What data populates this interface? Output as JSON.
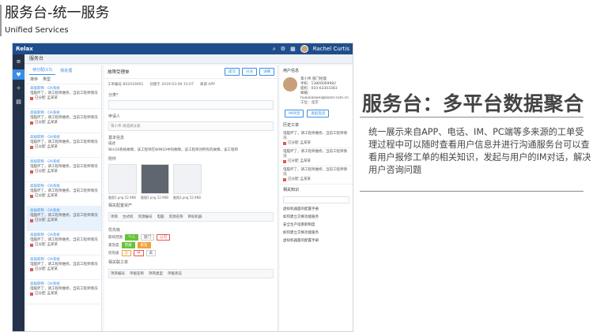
{
  "slide": {
    "title": "服务台-统一服务",
    "subtitle": "Unified Services",
    "headline": "服务台：多平台数据聚合",
    "description": "统一展示来自APP、电话、IM、PC端等多来源的工单受理过程中可以随时查看用户信息并进行沟通服务台可以查看用户报修工单的相关知识，发起与用户的IM对话，解决用户咨询问题"
  },
  "app": {
    "brand": "Relax",
    "user_name": "Rachel Curtis",
    "page_title": "服务台",
    "rail_icons": [
      "menu-icon",
      "heart-icon",
      "gear-icon",
      "document-icon"
    ],
    "list": {
      "tabs": [
        "待分配(13)",
        "我处理"
      ],
      "filter": [
        "排序",
        "类型"
      ],
      "tickets": [
        {
          "title": "高级职称 · OA系统",
          "desc": "电脑坏了，请工程师维修，当前工程师情况",
          "status": "已分配",
          "user": "孟某某"
        },
        {
          "title": "高级职称 · OA系统",
          "desc": "电脑坏了，请工程师维修，当前工程师情况",
          "status": "已分配",
          "user": "孟某某"
        },
        {
          "title": "高级职称 · OA系统",
          "desc": "电脑坏了，请工程师维修，当前工程师情况",
          "status": "已分配",
          "user": "孟某某"
        },
        {
          "title": "高级职称 · OA系统",
          "desc": "电脑坏了，请工程师维修，当前工程师情况",
          "status": "已分配",
          "user": "孟某某"
        },
        {
          "title": "高级职称 · OA系统",
          "desc": "电脑坏了，请工程师维修，当前工程师情况",
          "status": "已分配",
          "user": "孟某某"
        },
        {
          "title": "高级职称 · OA系统",
          "desc": "电脑坏了，请工程师维修，当前工程师情况",
          "status": "已分配",
          "user": "孟某某"
        },
        {
          "title": "高级职称 · OA系统",
          "desc": "电脑坏了，请工程师维修，当前工程师情况",
          "status": "已分配",
          "user": "孟某某"
        },
        {
          "title": "高级职称 · OA系统",
          "desc": "电脑坏了，请工程师维修，当前工程师情况",
          "status": "已分配",
          "user": "孟某某"
        },
        {
          "title": "高级职称 · OA系统",
          "desc": "电脑坏了，请工程师维修，当前工程师情况",
          "status": "已分配",
          "user": "孟某某"
        }
      ]
    },
    "detail": {
      "title": "故障受理单",
      "buttons": [
        "提交",
        "分派",
        "详细"
      ],
      "meta": [
        "工单编号 BS2019001",
        "创建于 2019-03-09 15:07",
        "来源 APP"
      ],
      "label_category": "分类*",
      "label_person": "申请人",
      "person_value": "蒋小伟 请选择分类",
      "label_desc": "基本信息",
      "desc_label": "描述",
      "desc_text": "Win10系统故障，该工程师在WIN10中的故障，该工程师对所有的故障，该工程师",
      "label_attach": "附件",
      "attachments": [
        "截图1.png 52.9KB",
        "截图2.png 52.9KB",
        "截图3.png 52.9KB"
      ],
      "related_assets": "相关配置资产",
      "assets_row": [
        "项目",
        "台式机",
        "资源编号",
        "电脑",
        "资源名称",
        "目标机器"
      ],
      "priority_label": "优先级",
      "priority_rows": [
        {
          "label": "影响范围",
          "pills": [
            "个人",
            "部门",
            "公司"
          ]
        },
        {
          "label": "紧急度",
          "pills": [
            "普通",
            "紧急"
          ]
        },
        {
          "label": "优先级",
          "pills": [
            "低",
            "中",
            "高"
          ]
        }
      ],
      "related_tickets": "相关联工单",
      "tickets_row": [
        "项目编号",
        "单据名称",
        "项目类型",
        "单据状态"
      ]
    },
    "side": {
      "user_section": "用户信息",
      "user_name": "蒋小伟",
      "user_role": "部门经理",
      "user_lines": [
        "手机：13800009982",
        "座机：010-63303383",
        "邮箱：huaixiaowei@kozer.com.cn",
        "工位：北京"
      ],
      "user_buttons": [
        "IM对话",
        "发起电话"
      ],
      "history_section": "历史工单",
      "history": [
        {
          "text": "电脑坏了，请工程师维修，当前工程师情况",
          "status": "已分配",
          "user": "孟某某"
        },
        {
          "text": "电脑坏了，请工程师维修，当前工程师情况",
          "status": "已分配",
          "user": "孟某某"
        },
        {
          "text": "电脑坏了，请工程师维修，当前工程师情况",
          "status": "已分配",
          "user": "孟某某"
        }
      ],
      "kb_section": "相关知识",
      "kb_items": [
        "虚拟机器面的配置手册",
        "如何建立交换功能服务",
        "安全生产指南新制度",
        "如何建立交换功能服务",
        "虚拟机器面的配置手册"
      ]
    }
  }
}
